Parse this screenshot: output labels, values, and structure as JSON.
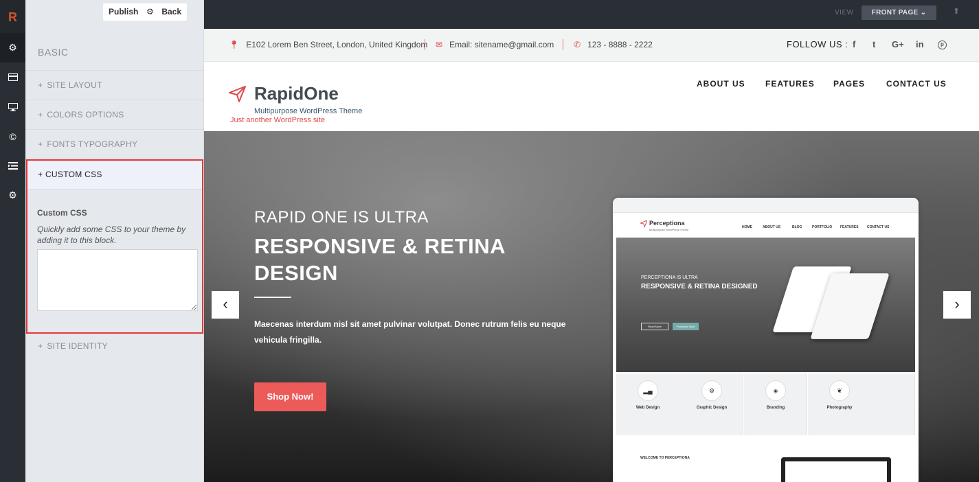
{
  "rail": {
    "logo": "R",
    "icons": [
      "gear-icon",
      "card-icon",
      "monitor-icon",
      "copyright-icon",
      "list-icon",
      "gear-icon"
    ]
  },
  "panel": {
    "publish": "Publish",
    "back": "Back",
    "basic": "BASIC",
    "sections": {
      "site_layout": "SITE LAYOUT",
      "colors_options": "COLORS OPTIONS",
      "fonts_typography": "FONTS TYPOGRAPHY",
      "custom_css": "CUSTOM CSS",
      "site_identity": "SITE IDENTITY"
    },
    "custom_css_label": "Custom CSS",
    "custom_css_desc": "Quickly add some CSS to your theme by adding it to this block.",
    "custom_css_value": ""
  },
  "preview_bar": {
    "view": "VIEW",
    "front_page": "FRONT PAGE"
  },
  "site": {
    "address": "E102 Lorem Ben Street, London, United Kingdom",
    "email": "Email: sitename@gmail.com",
    "phone": "123 - 8888 - 2222",
    "follow": "FOLLOW US :",
    "social": [
      "f",
      "t",
      "G+",
      "in",
      "p"
    ],
    "brand": "RapidOne",
    "tagline": "Multipurpose WordPress Theme",
    "subtitle": "Just another WordPress site",
    "nav": [
      "ABOUT US",
      "FEATURES",
      "PAGES",
      "CONTACT US"
    ],
    "hero": {
      "line1": "RAPID ONE IS ULTRA",
      "line2": "RESPONSIVE & RETINA DESIGN",
      "text": "Maecenas interdum nisl sit amet pulvinar volutpat. Donec rutrum felis eu neque vehicula fringilla.",
      "cta": "Shop Now!"
    },
    "mockup": {
      "brand": "Perceptiona",
      "tag": "Multipurpose WordPress Theme",
      "hero1": "PERCEPTIONA IS ULTRA",
      "hero2": "RESPONSIVE & RETINA DESIGNED",
      "read_more": "Read More",
      "purchase": "Purchase Now",
      "nav": [
        "HOME",
        "ABOUT US",
        "BLOG",
        "PORTFOLIO",
        "FEATURES",
        "CONTACT US"
      ],
      "cards": [
        "Web Design",
        "Graphic Design",
        "Branding",
        "Photography"
      ],
      "welcome": "WELCOME TO PERCEPTIONA"
    }
  },
  "colors": {
    "accent": "#ec5a5a",
    "rail": "#2a2f36"
  }
}
